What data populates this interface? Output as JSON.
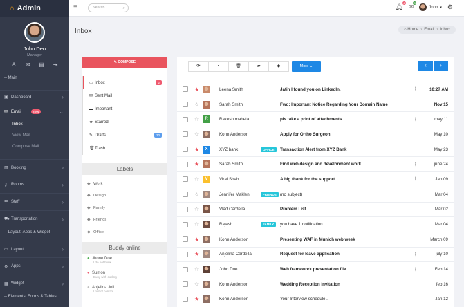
{
  "brand": {
    "name": "Admin"
  },
  "profile": {
    "name": "John Deo",
    "role": "Manager"
  },
  "topbar": {
    "search_placeholder": "Search...",
    "user_name": "John",
    "notif_count": "4",
    "mail_count": "3"
  },
  "nav": {
    "main_label": "-- Main",
    "dashboard": "Dashboard",
    "email": "Email",
    "email_badge": "new",
    "inbox": "Inbox",
    "view_mail": "View Mail",
    "compose_mail": "Compose Mail",
    "booking": "Booking",
    "rooms": "Rooms",
    "staff": "Staff",
    "transportation": "Transportation",
    "layout_section": "-- Layout, Apps & Widget",
    "layout": "Layout",
    "apps": "Apps",
    "widget": "Widget",
    "elements_section": "-- Elements, Forms & Tables"
  },
  "page": {
    "title": "Inbox",
    "breadcrumb": [
      "Home",
      "Email",
      "Inbox"
    ]
  },
  "mailbox": {
    "compose": "COMPOSE",
    "folders": [
      {
        "label": "Inbox",
        "badge": "2",
        "badge_color": "#ef5a6f"
      },
      {
        "label": "Sent Mail"
      },
      {
        "label": "Important"
      },
      {
        "label": "Starred"
      },
      {
        "label": "Drafts",
        "badge": "30",
        "badge_color": "#5c9ded"
      },
      {
        "label": "Trash"
      }
    ],
    "labels_title": "Labels",
    "labels": [
      "Work",
      "Design",
      "Family",
      "Friends",
      "Office"
    ],
    "buddy_title": "Buddy online",
    "buddies": [
      {
        "name": "Jhone Doe",
        "status": "I do not think",
        "color": "#4caf50"
      },
      {
        "name": "Sumon",
        "status": "Busy with coding",
        "color": "#ef5a6f"
      },
      {
        "name": "Anjelina Joli",
        "status": "I out of control",
        "color": "#bdbdbd"
      }
    ]
  },
  "toolbar": {
    "more": "More"
  },
  "emails": [
    {
      "from": "Leena Smith",
      "subject": "Jatin I found you on LinkedIn.",
      "date": "10:27 AM",
      "starred": true,
      "attach": true,
      "unread": true,
      "avatar": "photo",
      "color": "#c98a6a"
    },
    {
      "from": "Sarah Smith",
      "subject": "Fwd: Important Notice Regarding Your Domain Name",
      "date": "Nov 15",
      "starred": false,
      "attach": false,
      "unread": true,
      "avatar": "photo",
      "color": "#b5735a"
    },
    {
      "from": "Rakesh maheta",
      "subject": "pls take a print of attachments",
      "date": "may 11",
      "starred": false,
      "attach": true,
      "unread": false,
      "avatar": "R",
      "color": "#43a047"
    },
    {
      "from": "Kohn Anderson",
      "subject": "Apply for Ortho Surgeon",
      "date": "May 10",
      "starred": false,
      "attach": false,
      "unread": false,
      "avatar": "photo",
      "color": "#8d6e63"
    },
    {
      "from": "XYZ bank",
      "tag": "OFFICE",
      "subject": "Transaction Alert from XYZ Bank",
      "date": "May 23",
      "starred": true,
      "attach": false,
      "unread": false,
      "avatar": "X",
      "color": "#1e88e5"
    },
    {
      "from": "Sarah Smith",
      "subject": "Find web design and develonment work",
      "date": "june 24",
      "starred": true,
      "attach": true,
      "unread": false,
      "avatar": "photo",
      "color": "#b5735a"
    },
    {
      "from": "Viral Shah",
      "subject": "A big thank for the support",
      "date": "Jan 09",
      "starred": false,
      "attach": true,
      "unread": false,
      "avatar": "V",
      "color": "#fbc02d"
    },
    {
      "from": "Jennifer Maklen",
      "tag": "FRIENDS",
      "subject": "(no subject)",
      "date": "Mar 04",
      "starred": false,
      "attach": false,
      "unread": false,
      "bold_off": true,
      "avatar": "photo",
      "color": "#a1887f"
    },
    {
      "from": "Vlad Cardella",
      "subject": "Problem List",
      "date": "Mar 02",
      "starred": false,
      "attach": false,
      "unread": false,
      "avatar": "photo",
      "color": "#795548"
    },
    {
      "from": "Rajesh",
      "tag": "FAMILY",
      "subject": "you have 1 notification",
      "date": "Mar 04",
      "starred": false,
      "attach": false,
      "unread": false,
      "bold_off": true,
      "avatar": "photo",
      "color": "#6d4c41"
    },
    {
      "from": "Kohn Anderson",
      "subject": "Presenting WAF in Munich web week",
      "date": "March 09",
      "starred": true,
      "attach": false,
      "unread": false,
      "avatar": "photo",
      "color": "#8d6e63"
    },
    {
      "from": "Anjelina Cardella",
      "subject": "Request for leave application",
      "date": "july 10",
      "starred": true,
      "attach": true,
      "unread": false,
      "avatar": "photo",
      "color": "#a1887f"
    },
    {
      "from": "John Doe",
      "subject": "Web framework presentation file",
      "date": "Feb 14",
      "starred": false,
      "attach": true,
      "unread": false,
      "avatar": "photo",
      "color": "#5d4037"
    },
    {
      "from": "Kohn Anderson",
      "subject": "Wedding Reception Invitation",
      "date": "feb 16",
      "starred": false,
      "attach": false,
      "unread": false,
      "avatar": "photo",
      "color": "#8d6e63"
    },
    {
      "from": "Kohn Anderson",
      "subject": "Your Interview schedule...",
      "date": "Jan 12",
      "starred": true,
      "attach": false,
      "unread": false,
      "bold_off": true,
      "avatar": "photo",
      "color": "#8d6e63"
    }
  ]
}
